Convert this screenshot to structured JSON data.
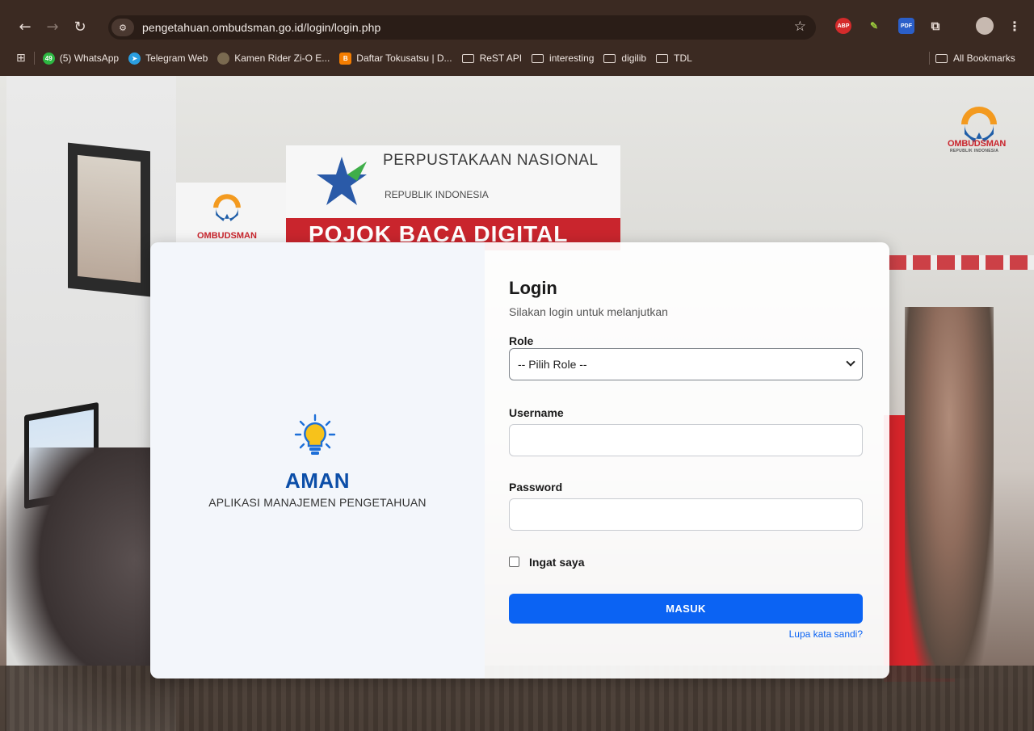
{
  "browser": {
    "url": "pengetahuan.ombudsman.go.id/login/login.php",
    "bookmarks": [
      {
        "label": "(5) WhatsApp",
        "icon": "whatsapp-icon"
      },
      {
        "label": "Telegram Web",
        "icon": "telegram-icon"
      },
      {
        "label": "Kamen Rider Zi-O E...",
        "icon": "site-icon"
      },
      {
        "label": "Daftar Tokusatsu | D...",
        "icon": "blogger-icon"
      },
      {
        "label": "ReST API",
        "icon": "folder-icon"
      },
      {
        "label": "interesting",
        "icon": "folder-icon"
      },
      {
        "label": "digilib",
        "icon": "folder-icon"
      },
      {
        "label": "TDL",
        "icon": "folder-icon"
      }
    ],
    "all_bookmarks": "All Bookmarks",
    "whatsapp_badge": "49",
    "ext_abp": "ABP",
    "ext_pdf": "PDF"
  },
  "background": {
    "sign_title": "PERPUSTAKAAN NASIONAL",
    "sign_sub": "REPUBLIK INDONESIA",
    "sign_banner": "POJOK BACA DIGITAL",
    "left_sign": "OMBUDSMAN",
    "corner_logo": "OMBUDSMAN",
    "corner_logo_sub": "REPUBLIK INDONESIA"
  },
  "brand": {
    "name": "AMAN",
    "tagline": "APLIKASI MANAJEMEN PENGETAHUAN"
  },
  "form": {
    "title": "Login",
    "subtitle": "Silakan login untuk melanjutkan",
    "role_label": "Role",
    "role_value": "-- Pilih Role --",
    "username_label": "Username",
    "username_value": "",
    "password_label": "Password",
    "password_value": "",
    "remember_label": "Ingat saya",
    "submit_label": "MASUK",
    "forgot_label": "Lupa kata sandi?"
  },
  "colors": {
    "accent": "#0b63f3",
    "brand_blue": "#0c4ea8",
    "chrome": "#3b2a22"
  }
}
